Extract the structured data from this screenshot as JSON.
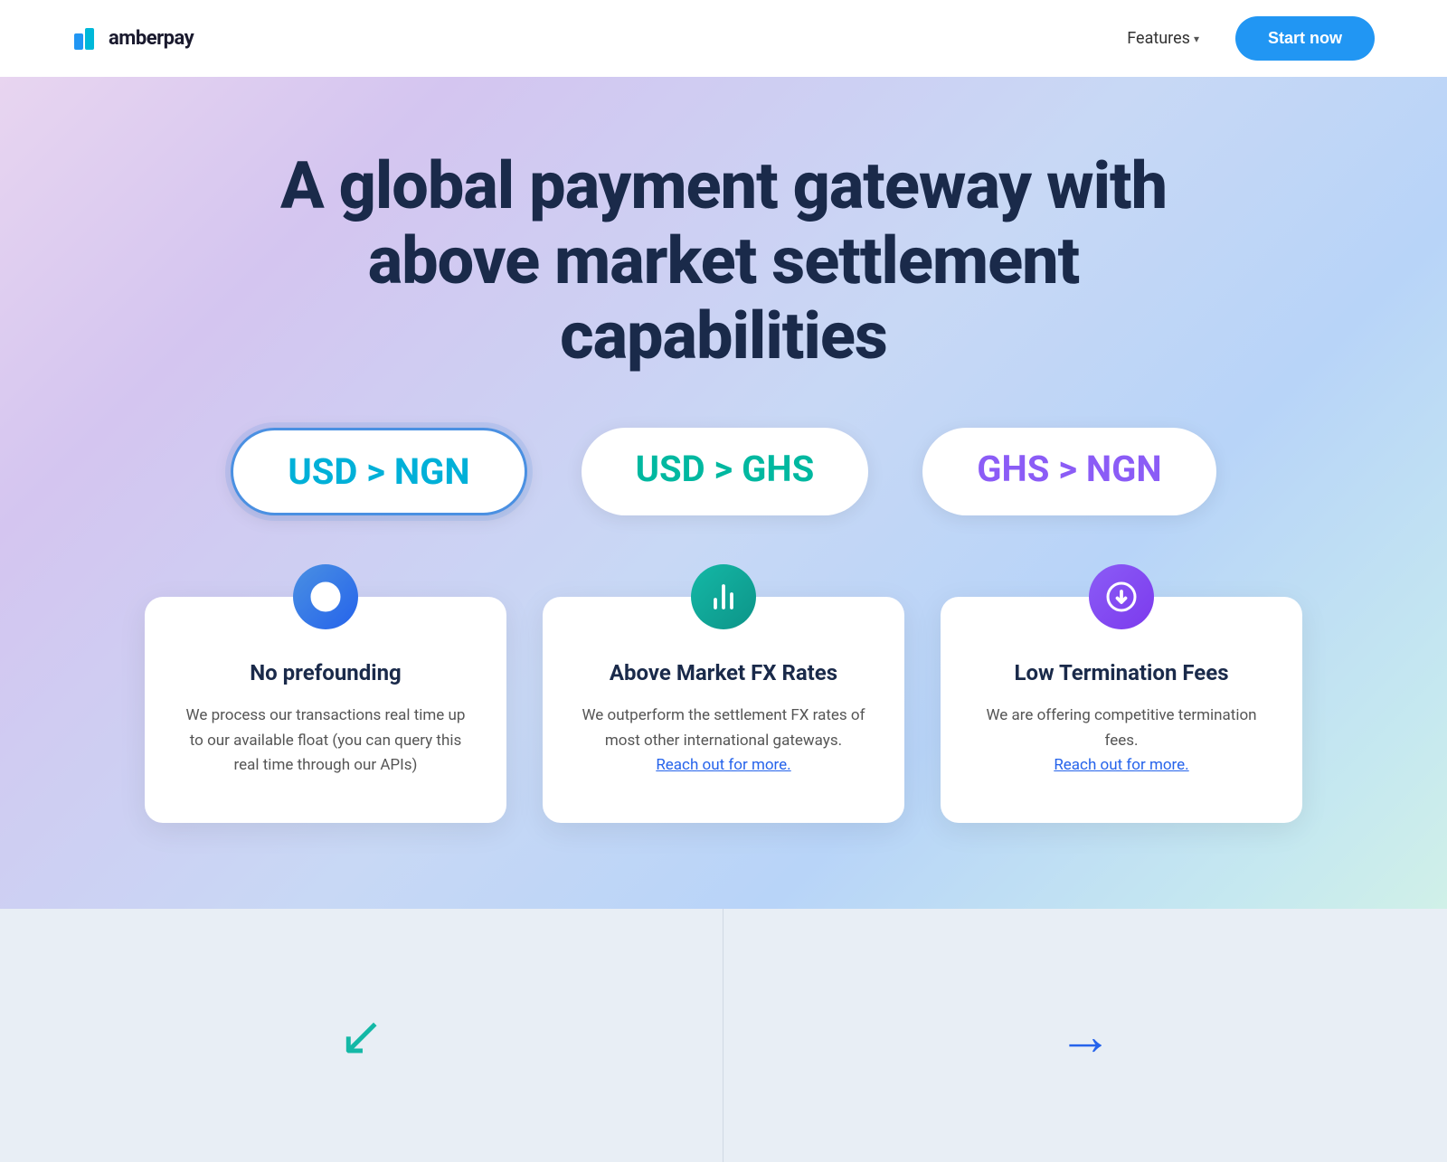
{
  "header": {
    "logo_text": "amberpay",
    "nav_features_label": "Features",
    "start_button_label": "Start now"
  },
  "hero": {
    "title": "A global payment gateway with above market settlement capabilities"
  },
  "currency_pills": [
    {
      "id": "usd-ngn",
      "label": "USD > NGN",
      "active": true,
      "color_class": "pill-usd-ngn"
    },
    {
      "id": "usd-ghs",
      "label": "USD > GHS",
      "active": false,
      "color_class": "pill-usd-ghs"
    },
    {
      "id": "ghs-ngn",
      "label": "GHS > NGN",
      "active": false,
      "color_class": "pill-ghs-ngn"
    }
  ],
  "feature_cards": [
    {
      "id": "no-prefunding",
      "icon": "clock",
      "icon_class": "icon-blue",
      "title": "No prefounding",
      "description": "We process our transactions real time up to our available float (you can query this real time through our APIs)",
      "link": null
    },
    {
      "id": "above-market-fx",
      "icon": "chart",
      "icon_class": "icon-teal",
      "title": "Above Market FX Rates",
      "description": "We outperform the settlement FX rates of most other international gateways.",
      "link": "Reach out for more."
    },
    {
      "id": "low-termination-fees",
      "icon": "download",
      "icon_class": "icon-purple",
      "title": "Low Termination Fees",
      "description": "We are offering competitive termination fees.",
      "link": "Reach out for more."
    }
  ],
  "bottom": {
    "left_arrow": "↙",
    "right_arrow": "→"
  }
}
